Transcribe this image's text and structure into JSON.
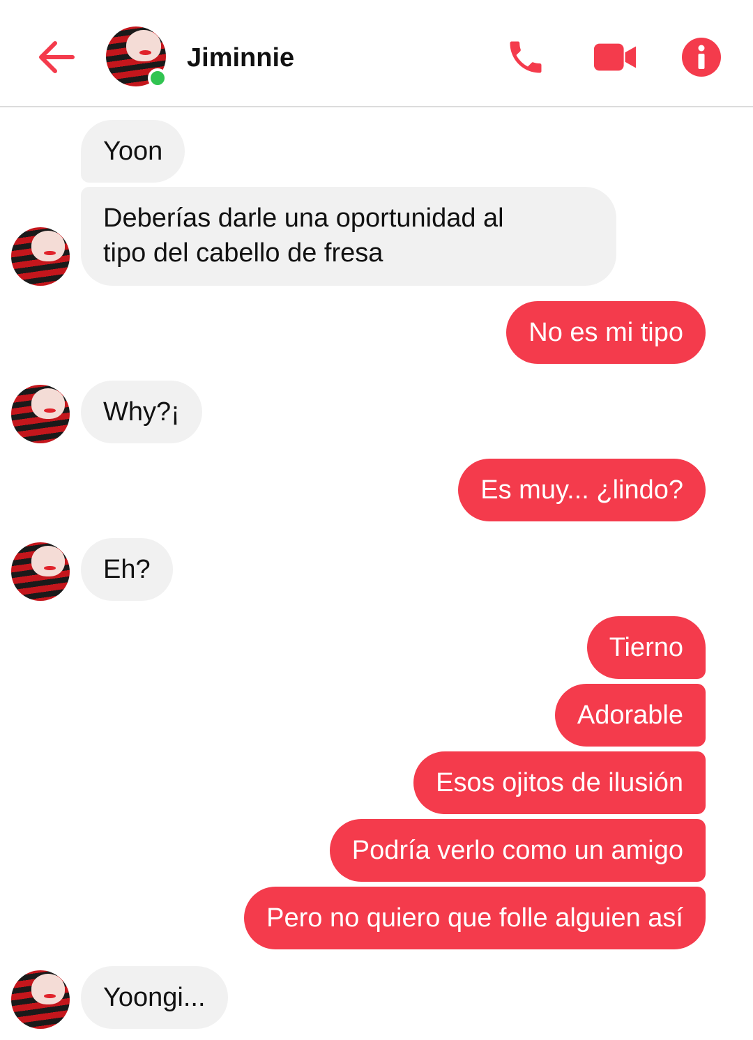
{
  "header": {
    "contact_name": "Jiminnie",
    "status": "online"
  },
  "colors": {
    "accent": "#f43b4c",
    "incoming_bubble": "#f1f1f1",
    "online": "#31c451"
  },
  "icons": [
    "back-arrow-icon",
    "phone-icon",
    "video-camera-icon",
    "info-icon"
  ],
  "messages": [
    {
      "from": "them",
      "text": "Yoon"
    },
    {
      "from": "them",
      "text": "Deberías darle una oportunidad al\ntipo del cabello de fresa"
    },
    {
      "from": "me",
      "text": "No es mi tipo"
    },
    {
      "from": "them",
      "text": "Why?¡"
    },
    {
      "from": "me",
      "text": "Es muy... ¿lindo?"
    },
    {
      "from": "them",
      "text": "Eh?"
    },
    {
      "from": "me",
      "text": "Tierno"
    },
    {
      "from": "me",
      "text": "Adorable"
    },
    {
      "from": "me",
      "text": "Esos ojitos de ilusión"
    },
    {
      "from": "me",
      "text": "Podría verlo como un amigo"
    },
    {
      "from": "me",
      "text": "Pero no quiero que folle alguien así"
    },
    {
      "from": "them",
      "text": "Yoongi..."
    }
  ]
}
